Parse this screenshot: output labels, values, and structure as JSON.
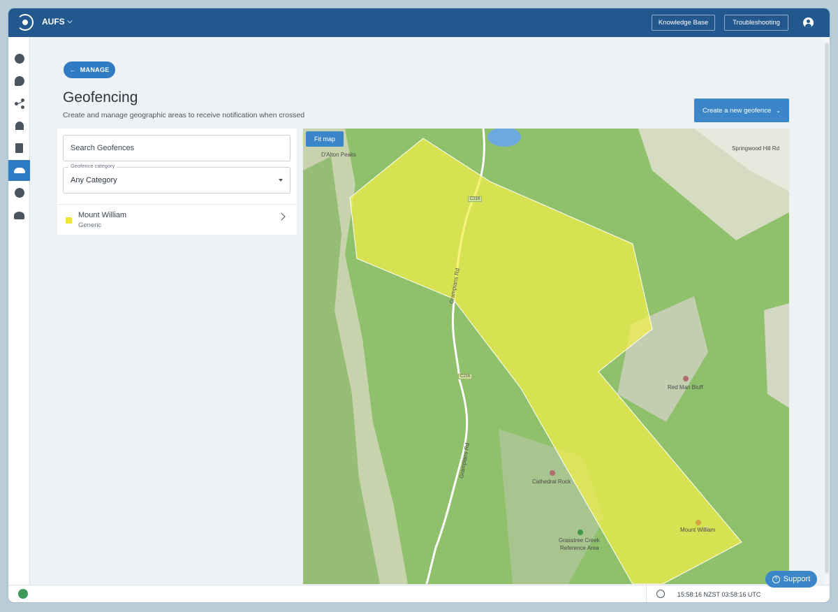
{
  "header": {
    "org_label": "AUFS",
    "knowledge_base_label": "Knowledge Base",
    "troubleshooting_label": "Troubleshooting"
  },
  "sidebar": {
    "items": [
      {
        "icon": "globe-icon"
      },
      {
        "icon": "chat-icon"
      },
      {
        "icon": "share-icon"
      },
      {
        "icon": "group-icon"
      },
      {
        "icon": "clipboard-icon"
      },
      {
        "icon": "geofence-icon",
        "active": true
      },
      {
        "icon": "gear-icon"
      },
      {
        "icon": "people-icon"
      }
    ]
  },
  "page": {
    "back_label": "MANAGE",
    "title": "Geofencing",
    "subtitle": "Create and manage geographic areas to receive notification when crossed",
    "create_label": "Create a new geofence"
  },
  "filters": {
    "search_placeholder": "Search Geofences",
    "category_label": "Geofence category",
    "category_value": "Any Category"
  },
  "geofences": [
    {
      "name": "Mount William",
      "type": "Generic",
      "color": "#f0e33a"
    }
  ],
  "map": {
    "fit_label": "Fit map",
    "labels": {
      "dalton": "D'Alton Peaks",
      "springwood": "Springwood Hill Rd",
      "c216_a": "C216",
      "c216_b": "C216",
      "red_man": "Red Man Bluff",
      "cathedral": "Cathedral Rock",
      "grasstree_1": "Grasstree Creek",
      "grasstree_2": "Reference Area",
      "mount_william": "Mount William",
      "grampians_1": "Grampians Rd",
      "grampians_2": "Grampians Rd"
    },
    "fill_color": "#f2ee4a"
  },
  "status": {
    "clock": "15:58:16 NZST 03:58:16 UTC",
    "support_label": "Support"
  }
}
